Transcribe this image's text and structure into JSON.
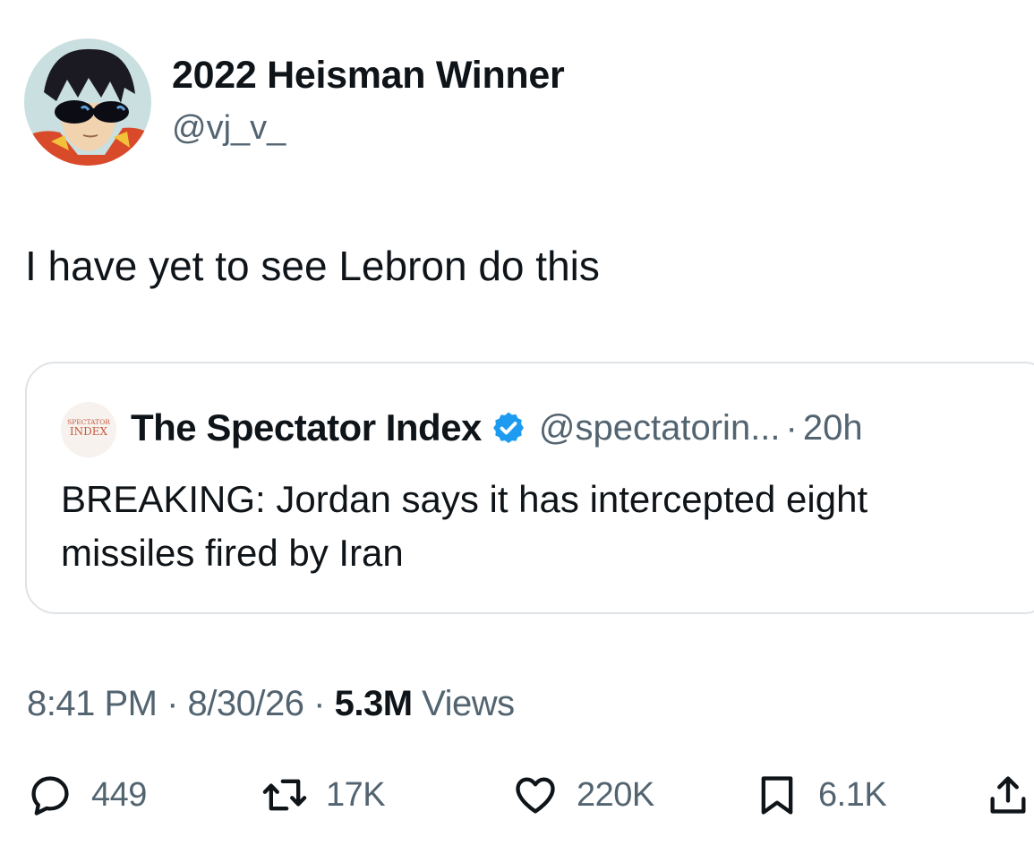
{
  "author": {
    "display_name": "2022 Heisman Winner",
    "handle": "@vj_v_",
    "avatar": "anime-character-sunglasses-avatar"
  },
  "tweet": {
    "text": "I have yet to see Lebron do this"
  },
  "quoted_tweet": {
    "avatar_line1": "SPECTATOR",
    "avatar_line2": "INDEX",
    "display_name": "The Spectator Index",
    "verified_icon": "verified-badge-icon",
    "handle": "@spectatorin...",
    "separator": "·",
    "time": "20h",
    "text": "BREAKING: Jordan says it has intercepted eight missiles fired by Iran"
  },
  "meta": {
    "time": "8:41 PM",
    "sep1": "·",
    "date": "8/30/26",
    "sep2": "·",
    "views_count": "5.3M",
    "views_label": "Views"
  },
  "actions": {
    "reply_count": "449",
    "retweet_count": "17K",
    "like_count": "220K",
    "bookmark_count": "6.1K"
  },
  "colors": {
    "text": "#0f1419",
    "secondary": "#536471",
    "border": "#dfe3e6",
    "verified": "#1d9bf0"
  }
}
